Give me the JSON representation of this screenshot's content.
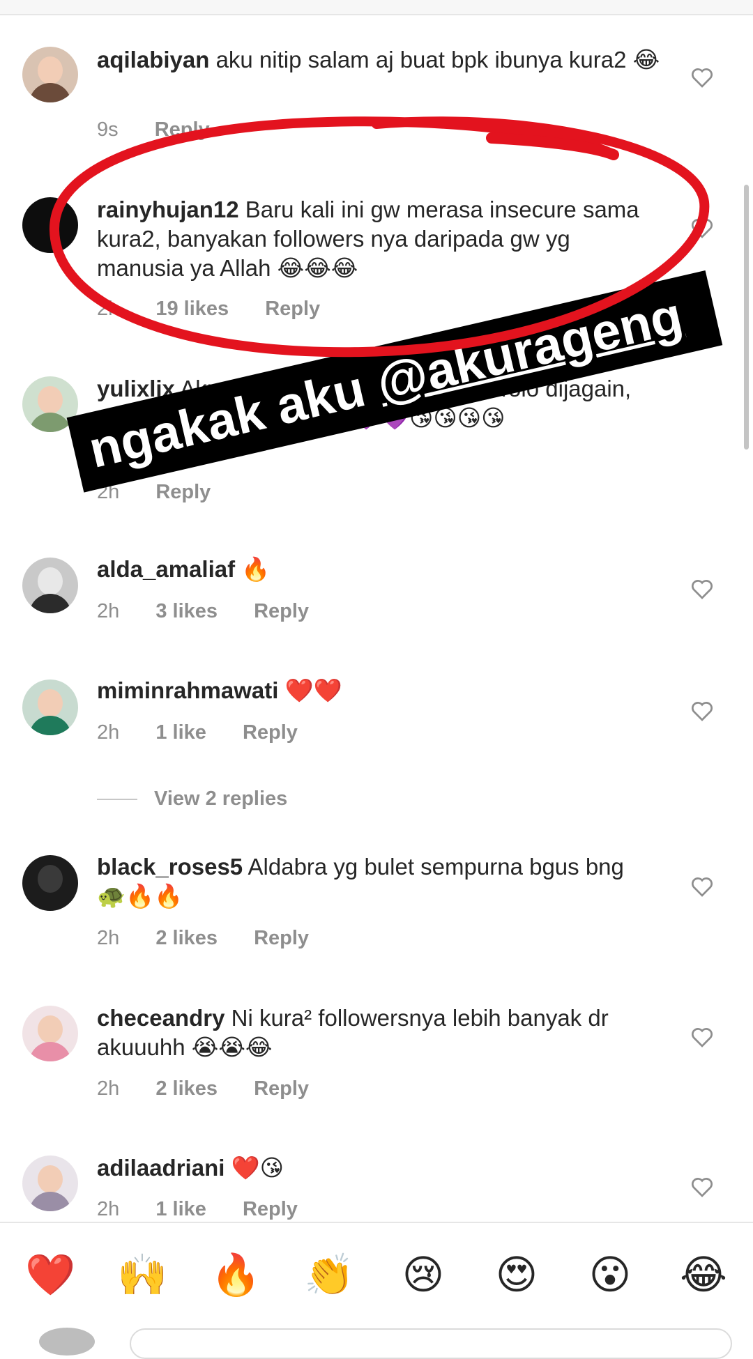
{
  "comments": [
    {
      "user": "aqilabiyan",
      "text": "aku nitip salam aj buat bpk ibunya kura2 😂",
      "time": "9s",
      "likes": "",
      "reply": "Reply"
    },
    {
      "user": "rainyhujan12",
      "text": "Baru kali ini gw merasa insecure sama kura2, banyakan followers nya daripada gw yg manusia ya Allah 😂😂😂",
      "time": "2h",
      "likes": "19 likes",
      "reply": "Reply"
    },
    {
      "user": "yulixlix",
      "text": "Aku nitip Mpok Nur aja Bang... Tolo dijagain, disayangi dan dicintai 💜💜💜😘😘😘😘",
      "time": "2h",
      "likes": "",
      "reply": "Reply"
    },
    {
      "user": "alda_amaliaf",
      "text": "🔥",
      "time": "2h",
      "likes": "3 likes",
      "reply": "Reply"
    },
    {
      "user": "miminrahmawati",
      "text": "❤️❤️",
      "time": "2h",
      "likes": "1 like",
      "reply": "Reply"
    },
    {
      "user": "black_roses5",
      "text": "Aldabra yg bulet sempurna bgus bng 🐢🔥🔥",
      "time": "2h",
      "likes": "2 likes",
      "reply": "Reply"
    },
    {
      "user": "checeandry",
      "text": "Ni kura² followersnya lebih banyak dr akuuuhh 😭😭😂",
      "time": "2h",
      "likes": "2 likes",
      "reply": "Reply"
    },
    {
      "user": "adilaadriani",
      "text": "❤️😘",
      "time": "2h",
      "likes": "1 like",
      "reply": "Reply"
    }
  ],
  "view_replies": "View 2 replies",
  "sticker": {
    "prefix": "ngakak aku ",
    "handle": "@akurageng"
  },
  "emoji_bar": [
    "❤️",
    "🙌",
    "🔥",
    "👏",
    "😢",
    "😍",
    "😮",
    "😂"
  ],
  "colors": {
    "highlight": "#e3131e",
    "muted": "#8e8e8e",
    "text": "#262626"
  },
  "icons": [
    "heart-outline-icon",
    "user-avatar-icon"
  ]
}
